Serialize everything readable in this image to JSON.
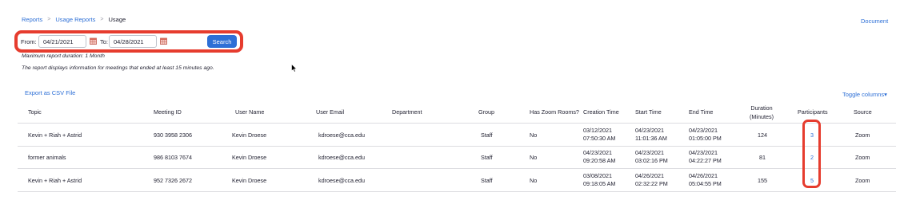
{
  "breadcrumb": {
    "items": [
      "Reports",
      "Usage Reports",
      "Usage"
    ],
    "separator": ">"
  },
  "header": {
    "document_link": "Document"
  },
  "filter": {
    "from_label": "From:",
    "from_value": "04/21/2021",
    "to_label": "To:",
    "to_value": "04/28/2021",
    "search_label": "Search",
    "highlight_color": "#e63c2e"
  },
  "notes": {
    "max_duration": "Maximum report duration: 1 Month",
    "info": "The report displays information for meetings that ended at least 15 minutes ago."
  },
  "actions": {
    "export_label": "Export as CSV File",
    "toggle_columns_label": "Toggle columns▾"
  },
  "table": {
    "headers": {
      "topic": "Topic",
      "meeting_id": "Meeting ID",
      "user_name": "User Name",
      "user_email": "User Email",
      "department": "Department",
      "group": "Group",
      "has_zoom_rooms": "Has Zoom Rooms?",
      "creation_time": "Creation Time",
      "start_time": "Start Time",
      "end_time": "End Time",
      "duration_line1": "Duration",
      "duration_line2": "(Minutes)",
      "participants": "Participants",
      "source": "Source"
    },
    "rows": [
      {
        "topic": "Kevin + Riah + Astrid",
        "meeting_id": "930 3958 2306",
        "user_name": "Kevin Droese",
        "user_email": "kdroese@cca.edu",
        "group": "Staff",
        "has_zoom_rooms": "No",
        "creation_date": "03/12/2021",
        "creation_clock": "07:50:30 AM",
        "start_date": "04/23/2021",
        "start_clock": "11:01:36 AM",
        "end_date": "04/23/2021",
        "end_clock": "01:05:00 PM",
        "duration": "124",
        "participants": "3",
        "source": "Zoom"
      },
      {
        "topic": "former animals",
        "meeting_id": "986 8103 7674",
        "user_name": "Kevin Droese",
        "user_email": "kdroese@cca.edu",
        "group": "Staff",
        "has_zoom_rooms": "No",
        "creation_date": "04/23/2021",
        "creation_clock": "09:20:58 AM",
        "start_date": "04/23/2021",
        "start_clock": "03:02:16 PM",
        "end_date": "04/23/2021",
        "end_clock": "04:22:27 PM",
        "duration": "81",
        "participants": "2",
        "source": "Zoom"
      },
      {
        "topic": "Kevin + Riah + Astrid",
        "meeting_id": "952 7326 2672",
        "user_name": "Kevin Droese",
        "user_email": "kdroese@cca.edu",
        "group": "Staff",
        "has_zoom_rooms": "No",
        "creation_date": "03/08/2021",
        "creation_clock": "09:18:05 AM",
        "start_date": "04/26/2021",
        "start_clock": "02:32:22 PM",
        "end_date": "04/26/2021",
        "end_clock": "05:04:55 PM",
        "duration": "155",
        "participants": "5",
        "source": "Zoom"
      }
    ]
  },
  "colors": {
    "link": "#2d6fd6",
    "button": "#2d6fd6",
    "highlight": "#e63c2e",
    "text": "#232333",
    "divider": "#dcdce0"
  }
}
